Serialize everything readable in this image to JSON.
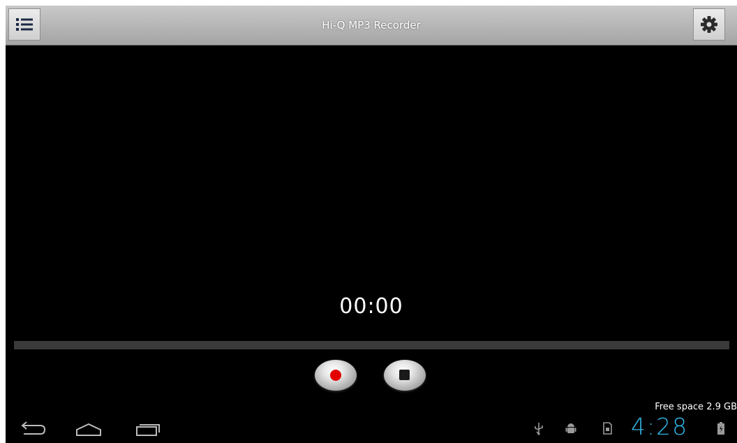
{
  "app": {
    "title": "Hi-Q MP3 Recorder"
  },
  "actionbar": {
    "menu_icon": "list-menu-icon",
    "settings_icon": "gear-icon"
  },
  "player": {
    "elapsed": "00:00",
    "progress": 0,
    "record_icon": "record-icon",
    "stop_icon": "stop-icon"
  },
  "statusbar": {
    "free_space": "Free space 2.9 GB",
    "clock": "4:28",
    "icons": [
      "back-icon",
      "home-icon",
      "recent-apps-icon",
      "usb-icon",
      "android-debug-icon",
      "sd-card-icon",
      "battery-icon"
    ]
  },
  "colors": {
    "clock": "#33b5e5",
    "record_dot": "#e30000",
    "background": "#000000",
    "actionbar": "#b5b5b5"
  }
}
